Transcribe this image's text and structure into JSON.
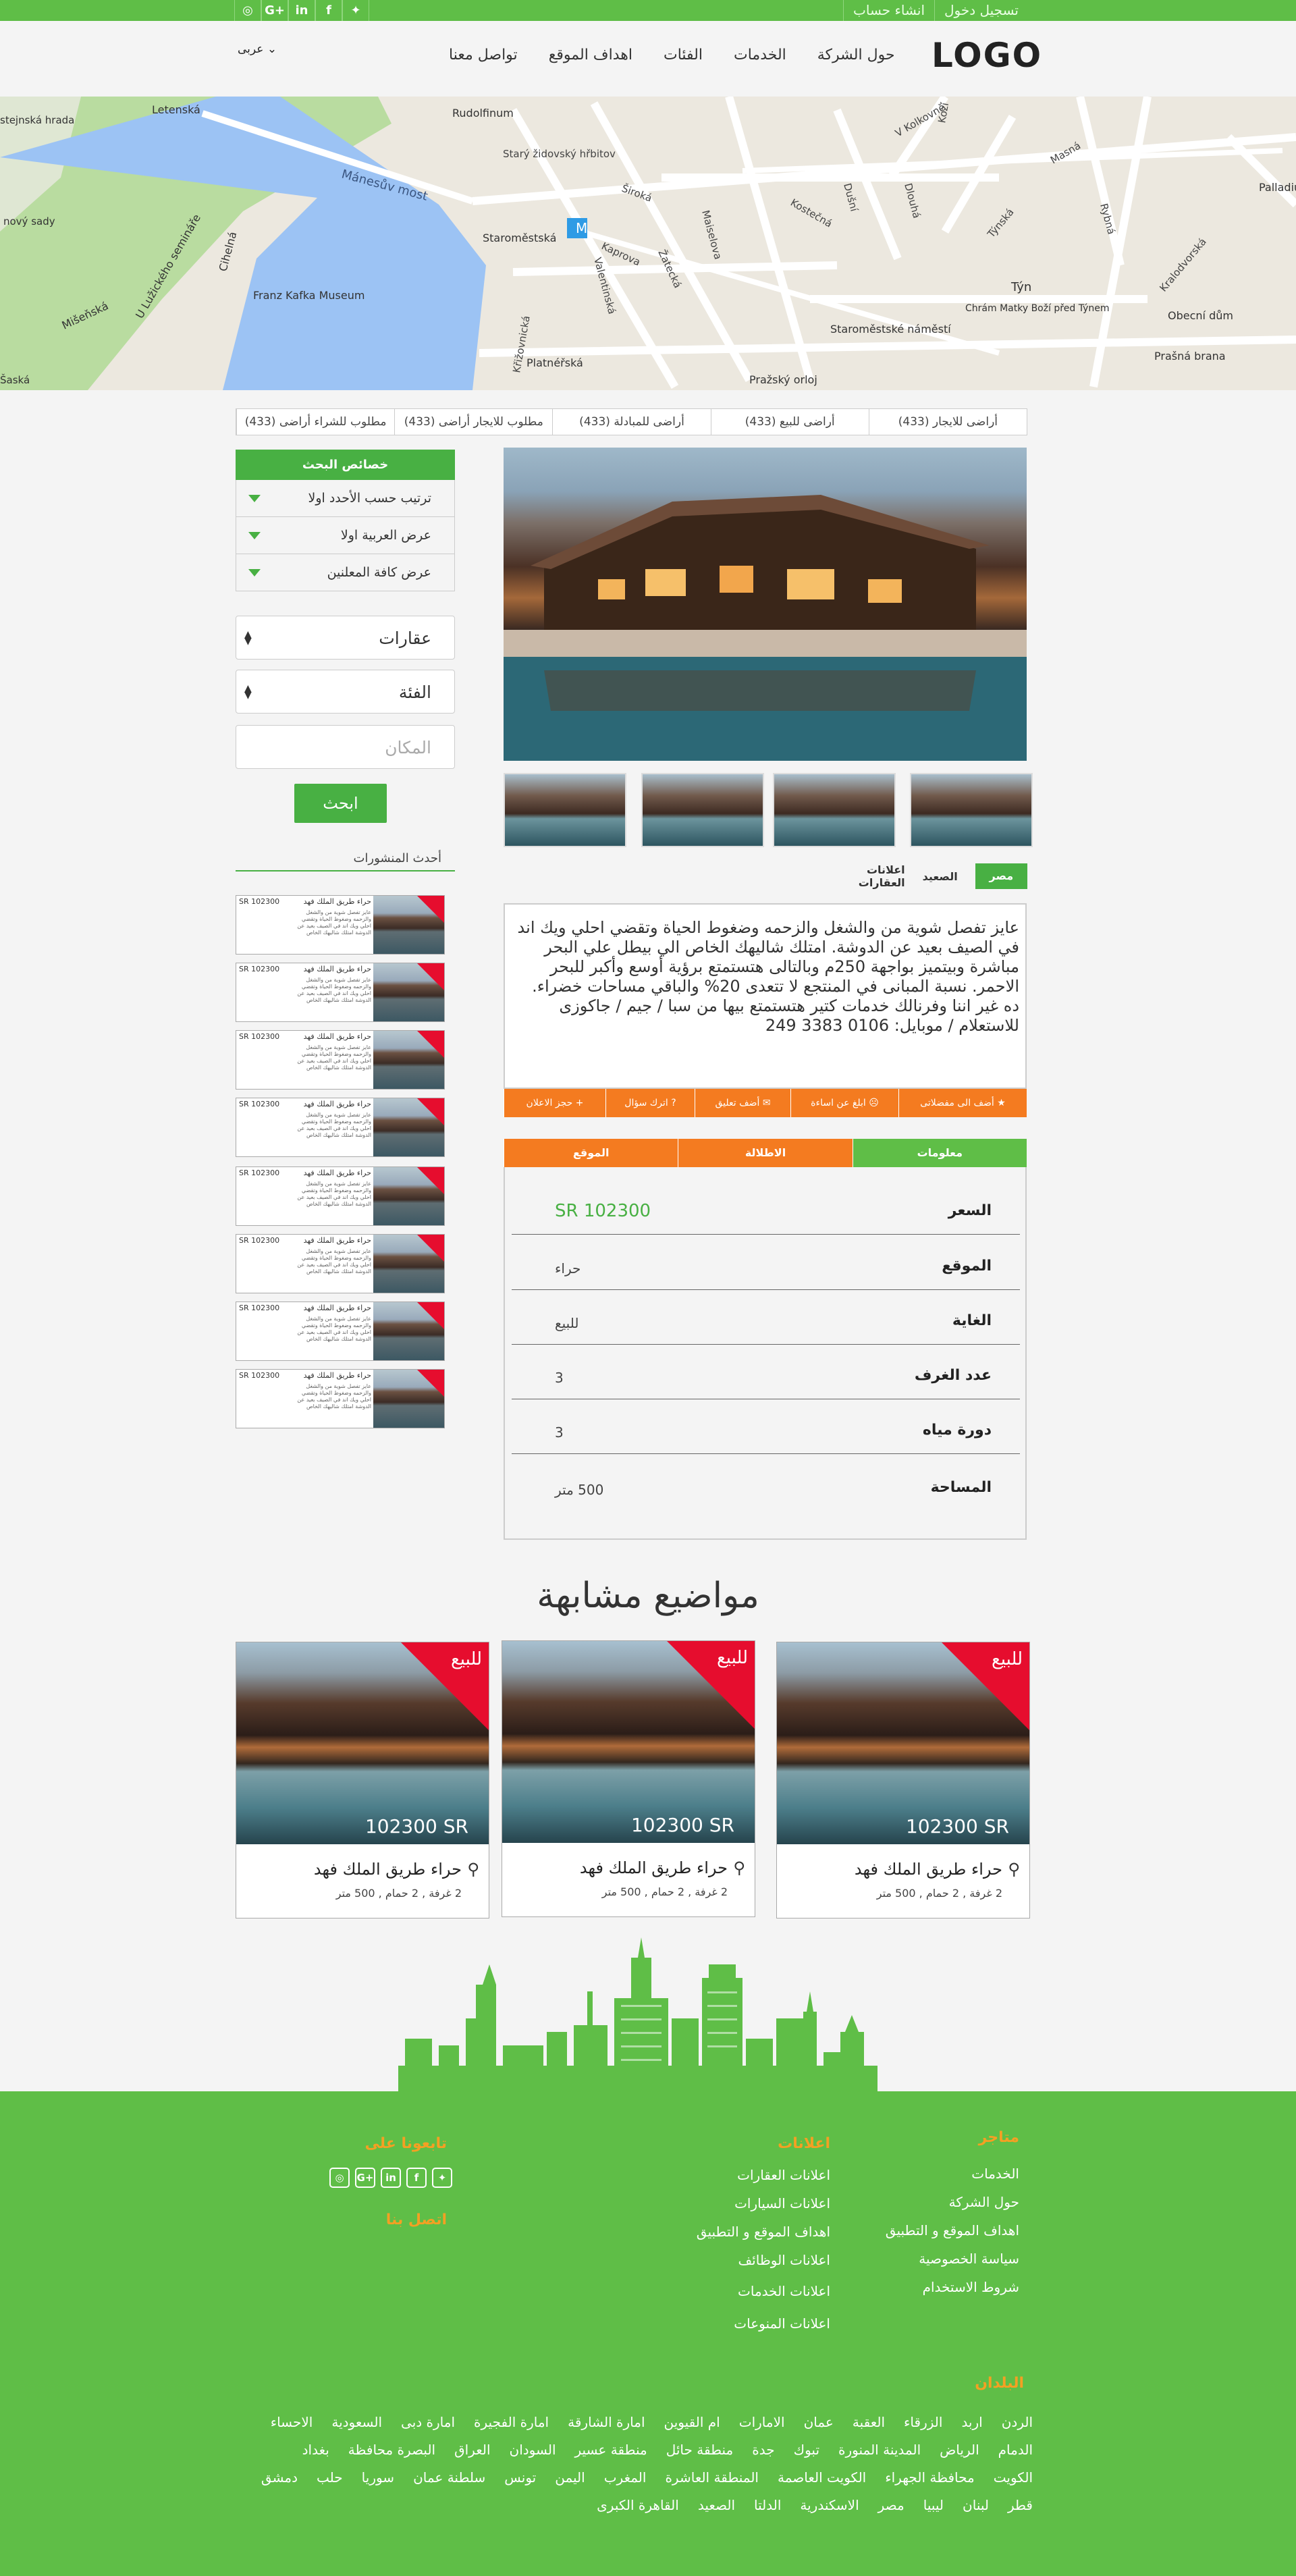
{
  "topbar": {
    "links": [
      "تسجيل دخول",
      "انشاء حساب"
    ],
    "social_icons": [
      "twitter-icon",
      "facebook-icon",
      "linkedin-icon",
      "google-plus-icon",
      "instagram-icon"
    ]
  },
  "header": {
    "logo": "LOGO",
    "language": "عربى",
    "nav": [
      "حول الشركة",
      "الخدمات",
      "الفئات",
      "اهداف الموقع",
      "تواصل معنا"
    ]
  },
  "map": {
    "labels": [
      "Letenská",
      "Mánesův most",
      "Rudolfinum",
      "Starý židovský hřbitov",
      "Staroměstská",
      "Franz Kafka Museum",
      "Křižovnická",
      "Platnéřská",
      "Valentinská",
      "Kaprova",
      "Žatecká",
      "Maiselova",
      "Široká",
      "Kostečná",
      "Dušní",
      "Dlouhá",
      "V Kolkovně",
      "Kozí",
      "Týn",
      "Chrám Matky Boží před Týnem",
      "Staroměstské náměstí",
      "Pražský orloj",
      "Masná",
      "Týnská",
      "Rybná",
      "Kralodvorská",
      "Obecní dům",
      "Prašná brana",
      "Mišeňská",
      "U Lužického semináře",
      "Cihelná",
      "Palladiu",
      "Šaská",
      "stejnská hrada",
      "nový sady"
    ]
  },
  "tabs": [
    {
      "label": "أراضى للايجار",
      "count": "(433)"
    },
    {
      "label": "أراضى للبيع",
      "count": "(433)"
    },
    {
      "label": "أراضى للمبادلة",
      "count": "(433)"
    },
    {
      "label": "مطلوب للايجار أراضى",
      "count": "(433)"
    },
    {
      "label": "مطلوب للشراء أراضى",
      "count": "(433)"
    }
  ],
  "sidebar": {
    "title": "خصائص البحث",
    "filters": [
      "ترتيب حسب الأحدد اولا",
      "عرض العربية اولا",
      "عرض كافة المعلنين"
    ],
    "select_category": "عقارات",
    "select_type": "الفئة",
    "place_placeholder": "المكان",
    "search_button": "ابحث",
    "latest_title": "أحدث المنشورات",
    "posts": [
      {
        "price": "102300 SR",
        "title": "حراء طريق الملك فهد",
        "text": "عايز تفصل شوية من والشغل والزحمه وضغوط الحياة وتقضي احلي ويك اند في الصيف بعيد عن الدوشة امتلك شاليهك الخاص",
        "badge": "للبيع"
      },
      {
        "price": "102300 SR",
        "title": "حراء طريق الملك فهد",
        "text": "عايز تفصل شوية من والشغل والزحمه وضغوط الحياة وتقضي احلي ويك اند في الصيف بعيد عن الدوشة امتلك شاليهك الخاص",
        "badge": "للبيع"
      },
      {
        "price": "102300 SR",
        "title": "حراء طريق الملك فهد",
        "text": "عايز تفصل شوية من والشغل والزحمه وضغوط الحياة وتقضي احلي ويك اند في الصيف بعيد عن الدوشة امتلك شاليهك الخاص",
        "badge": "للبيع"
      },
      {
        "price": "102300 SR",
        "title": "حراء طريق الملك فهد",
        "text": "عايز تفصل شوية من والشغل والزحمه وضغوط الحياة وتقضي احلي ويك اند في الصيف بعيد عن الدوشة امتلك شاليهك الخاص",
        "badge": "للبيع"
      },
      {
        "price": "102300 SR",
        "title": "حراء طريق الملك فهد",
        "text": "عايز تفصل شوية من والشغل والزحمه وضغوط الحياة وتقضي احلي ويك اند في الصيف بعيد عن الدوشة امتلك شاليهك الخاص",
        "badge": "للبيع"
      },
      {
        "price": "102300 SR",
        "title": "حراء طريق الملك فهد",
        "text": "عايز تفصل شوية من والشغل والزحمه وضغوط الحياة وتقضي احلي ويك اند في الصيف بعيد عن الدوشة امتلك شاليهك الخاص",
        "badge": "للبيع"
      },
      {
        "price": "102300 SR",
        "title": "حراء طريق الملك فهد",
        "text": "عايز تفصل شوية من والشغل والزحمه وضغوط الحياة وتقضي احلي ويك اند في الصيف بعيد عن الدوشة امتلك شاليهك الخاص",
        "badge": "للبيع"
      },
      {
        "price": "102300 SR",
        "title": "حراء طريق الملك فهد",
        "text": "عايز تفصل شوية من والشغل والزحمه وضغوط الحياة وتقضي احلي ويك اند في الصيف بعيد عن الدوشة امتلك شاليهك الخاص",
        "badge": "للبيع"
      }
    ]
  },
  "listing": {
    "breadcrumb": [
      "مصر",
      "الصعيد",
      "اعلانات العقارات"
    ],
    "description": "عايز تفصل شوية من والشغل والزحمه وضغوط الحياة وتقضي احلي ويك اند في الصيف بعيد عن الدوشة. امتلك شاليهك الخاص الي بيطل علي البحر مباشرة وبيتميز بواجهة 250م وبالتالى هتستمتع برؤية أوسع وأكبر للبحر الاحمر. نسبة المبانى في المنتجع لا تتعدى 20% والباقي مساحات خضراء. ده غير اننا وفرنالك خدمات كتير هتستمتع بيها من سبا / جيم / جاكوزى للاستعلام / موبايل: 0106 3383 249",
    "actions": [
      "أضف الى مفضلاتى",
      "ابلغ عن اساءة",
      "أضف تعليق",
      "اترك سؤال",
      "حجز الاعلان"
    ],
    "action_icons": [
      "star-icon",
      "sad-face-icon",
      "comment-icon",
      "question-icon",
      "plus-icon"
    ],
    "info_tabs": [
      "معلومات",
      "الاطلالة",
      "الموقع"
    ],
    "details": [
      {
        "key": "السعر",
        "value": "102300 SR"
      },
      {
        "key": "الموقع",
        "value": "حراء"
      },
      {
        "key": "الغاية",
        "value": "للبيع"
      },
      {
        "key": "عدد الغرف",
        "value": "3"
      },
      {
        "key": "دورة مياه",
        "value": "3"
      },
      {
        "key": "المساحة",
        "value": "500 متر"
      }
    ]
  },
  "similar": {
    "title": "مواضيع مشابهة",
    "cards": [
      {
        "badge": "للبيع",
        "price": "102300 SR",
        "address": "حراء طريق الملك فهد",
        "meta": "2 غرفة , 2 حمام , 500 متر"
      },
      {
        "badge": "للبيع",
        "price": "102300 SR",
        "address": "حراء طريق الملك فهد",
        "meta": "2 غرفة , 2 حمام , 500 متر"
      },
      {
        "badge": "للبيع",
        "price": "102300 SR",
        "address": "حراء طريق الملك فهد",
        "meta": "2 غرفة , 2 حمام , 500 متر"
      }
    ]
  },
  "footer": {
    "col1_title": "متاجر",
    "col1": [
      "الخدمات",
      "حول الشركة",
      "اهداف الموقع و التطبيق",
      "سياسة الخصوصية",
      "شروط الاستخدام"
    ],
    "col2_title": "اعلانات",
    "col2": [
      "اعلانات العقارات",
      "اعلانات السيارات",
      "اهداف الموقع و التطبيق",
      "اعلانات الوظائف",
      "اعلانات الخدمات",
      "اعلانات المنوعات"
    ],
    "follow_title": "تابعونا على",
    "contact_title": "اتصل بنا",
    "countries_title": "البلدان",
    "countries": [
      "الردن",
      "اربد",
      "الزرقاء",
      "العقبة",
      "عمان",
      "الامارات",
      "ام القيوين",
      "امارة الشارقة",
      "امارة الفجيرة",
      "امارة دبى",
      "السعودية",
      "الاحساء",
      "الدمام",
      "الرياض",
      "المدينة المنورة",
      "تبوك",
      "جدة",
      "منطقة حائل",
      "منطقة عسير",
      "السودان",
      "العراق",
      "البصرة محافظة",
      "بغداد",
      "الكويت",
      "محافظة الجهراء",
      "الكويت العاصمة",
      "المنطقة العاشرة",
      "المغرب",
      "اليمن",
      "تونس",
      "سلطنة عمان",
      "سوريا",
      "حلب",
      "دمشق",
      "قطر",
      "لبنان",
      "ليبيا",
      "مصر",
      "الاسكندرية",
      "الدلتا",
      "الصعيد",
      "القاهرة الكبرى"
    ]
  },
  "colors": {
    "green": "#5fbe47",
    "dark_green": "#48b043",
    "orange": "#f47b20",
    "red": "#e60d2e",
    "footer_heading": "#f4a023"
  }
}
